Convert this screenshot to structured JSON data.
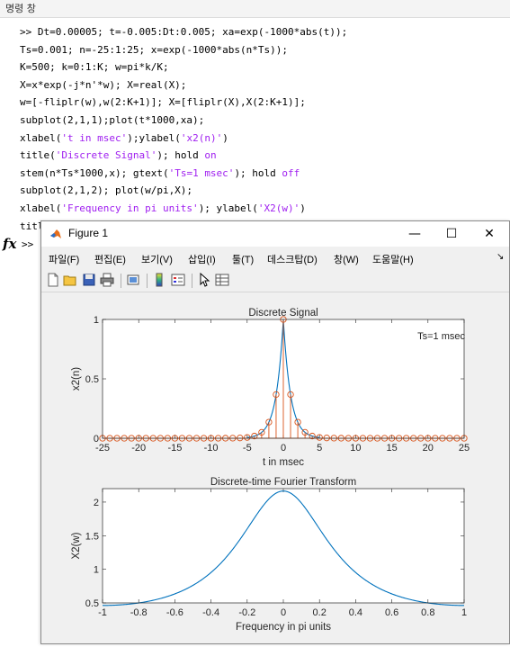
{
  "command_window": {
    "header": "명령 창",
    "lines": [
      [
        {
          "t": ">> Dt=0.00005; t=-0.005:Dt:0.005; xa=exp(-1000*abs(t));"
        }
      ],
      [
        {
          "t": "Ts=0.001; n=-25:1:25; x=exp(-1000*abs(n*Ts));"
        }
      ],
      [
        {
          "t": "K=500; k=0:1:K; w=pi*k/K;"
        }
      ],
      [
        {
          "t": "X=x*exp(-j*n'*w); X=real(X);"
        }
      ],
      [
        {
          "t": "w=[-fliplr(w),w(2:K+1)]; X=[fliplr(X),X(2:K+1)];"
        }
      ],
      [
        {
          "t": "subplot(2,1,1);plot(t*1000,xa);"
        }
      ],
      [
        {
          "t": "xlabel("
        },
        {
          "t": "'t in msec'",
          "s": 1
        },
        {
          "t": ");ylabel("
        },
        {
          "t": "'x2(n)'",
          "s": 1
        },
        {
          "t": ")"
        }
      ],
      [
        {
          "t": "title("
        },
        {
          "t": "'Discrete Signal'",
          "s": 1
        },
        {
          "t": "); hold "
        },
        {
          "t": "on",
          "s": 1
        }
      ],
      [
        {
          "t": "stem(n*Ts*1000,x); gtext("
        },
        {
          "t": "'Ts=1 msec'",
          "s": 1
        },
        {
          "t": "); hold "
        },
        {
          "t": "off",
          "s": 1
        }
      ],
      [
        {
          "t": "subplot(2,1,2); plot(w/pi,X);"
        }
      ],
      [
        {
          "t": "xlabel("
        },
        {
          "t": "'Frequency in pi units'",
          "s": 1
        },
        {
          "t": "); ylabel("
        },
        {
          "t": "'X2(w)'",
          "s": 1
        },
        {
          "t": ")"
        }
      ],
      [
        {
          "t": "title("
        },
        {
          "t": "'Discrete-time Fourier Transform'",
          "s": 1
        },
        {
          "t": ")"
        }
      ]
    ],
    "prompt": ">>",
    "fx_label": "fx"
  },
  "figure": {
    "title": "Figure 1",
    "minimize": "—",
    "maximize": "☐",
    "close": "✕",
    "menu": [
      "파일(F)",
      "편집(E)",
      "보기(V)",
      "삽입(I)",
      "툴(T)",
      "데스크탑(D)",
      "창(W)",
      "도움말(H)"
    ],
    "menu_arrow": "↘",
    "toolbar_icons": [
      "new-file-icon",
      "open-file-icon",
      "save-icon",
      "print-icon",
      "link-plot-icon",
      "colorbar-icon",
      "legend-icon",
      "pointer-icon",
      "property-inspector-icon"
    ]
  },
  "chart_data": [
    {
      "type": "line",
      "title": "Discrete Signal",
      "xlabel": "t in msec",
      "ylabel": "x2(n)",
      "xlim": [
        -25,
        25
      ],
      "ylim": [
        0,
        1
      ],
      "xticks": [
        -25,
        -20,
        -15,
        -10,
        -5,
        0,
        5,
        10,
        15,
        20,
        25
      ],
      "yticks": [
        0,
        0.5,
        1
      ],
      "line_color": "#0072BD",
      "stem_color": "#D95319",
      "annotation": "Ts=1 msec",
      "series": [
        {
          "kind": "line",
          "x_range": [
            -5,
            5
          ]
        },
        {
          "kind": "stem",
          "n": [
            -25,
            -24,
            -23,
            -22,
            -21,
            -20,
            -19,
            -18,
            -17,
            -16,
            -15,
            -14,
            -13,
            -12,
            -11,
            -10,
            -9,
            -8,
            -7,
            -6,
            -5,
            -4,
            -3,
            -2,
            -1,
            0,
            1,
            2,
            3,
            4,
            5,
            6,
            7,
            8,
            9,
            10,
            11,
            12,
            13,
            14,
            15,
            16,
            17,
            18,
            19,
            20,
            21,
            22,
            23,
            24,
            25
          ],
          "values": [
            0,
            0,
            0,
            0,
            0,
            0,
            0,
            0,
            0,
            0,
            0,
            0,
            0,
            0,
            0,
            0.0001,
            0.0001,
            0.0003,
            0.0009,
            0.0025,
            0.0067,
            0.0183,
            0.0498,
            0.1353,
            0.3679,
            1,
            0.3679,
            0.1353,
            0.0498,
            0.0183,
            0.0067,
            0.0025,
            0.0009,
            0.0003,
            0.0001,
            0.0001,
            0,
            0,
            0,
            0,
            0,
            0,
            0,
            0,
            0,
            0,
            0,
            0,
            0,
            0,
            0
          ]
        }
      ]
    },
    {
      "type": "line",
      "title": "Discrete-time Fourier Transform",
      "xlabel": "Frequency in pi units",
      "ylabel": "X2(w)",
      "xlim": [
        -1,
        1
      ],
      "ylim": [
        0.5,
        2.2
      ],
      "xticks": [
        -1,
        -0.8,
        -0.6,
        -0.4,
        -0.2,
        0,
        0.2,
        0.4,
        0.6,
        0.8,
        1
      ],
      "yticks": [
        0.5,
        1,
        1.5,
        2
      ],
      "line_color": "#0072BD",
      "x": [
        -1,
        -0.9,
        -0.8,
        -0.7,
        -0.6,
        -0.5,
        -0.4,
        -0.3,
        -0.2,
        -0.1,
        0,
        0.1,
        0.2,
        0.3,
        0.4,
        0.5,
        0.6,
        0.7,
        0.8,
        0.9,
        1
      ],
      "y": [
        0.462,
        0.475,
        0.514,
        0.583,
        0.685,
        0.819,
        0.984,
        1.276,
        1.61,
        1.989,
        2.164,
        1.989,
        1.61,
        1.276,
        0.984,
        0.819,
        0.685,
        0.583,
        0.514,
        0.475,
        0.462
      ]
    }
  ]
}
